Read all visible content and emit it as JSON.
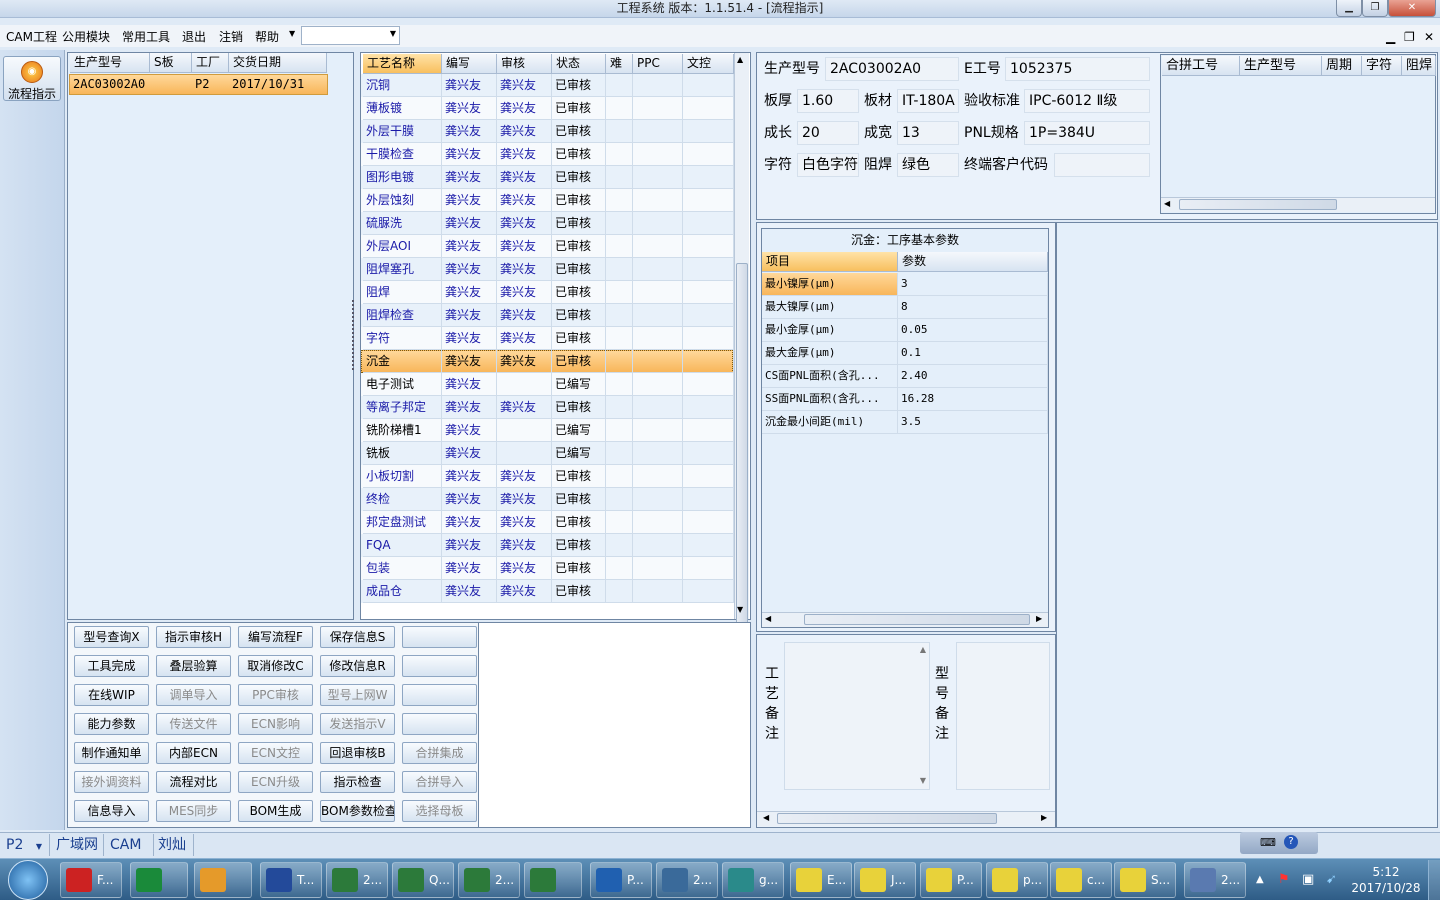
{
  "window": {
    "title": "工程系统    版本：1.1.51.4 - [流程指示]",
    "min_icon": "minimize-icon",
    "max_icon": "maximize-icon",
    "close_icon": "close-icon"
  },
  "menu": {
    "items": [
      "CAM工程",
      "公用模块",
      "常用工具",
      "退出",
      "注销",
      "帮助"
    ],
    "combo_value": ""
  },
  "nav": {
    "flow_button": "流程指示"
  },
  "orders": {
    "columns": [
      "生产型号",
      "S板",
      "工厂",
      "交货日期"
    ],
    "rows": [
      [
        "2AC03002A0",
        "",
        "P2",
        "2017/10/31"
      ]
    ]
  },
  "process": {
    "columns": [
      "工艺名称",
      "编写",
      "审核",
      "状态",
      "难",
      "PPC",
      "文控"
    ],
    "selected_index": 12,
    "rows": [
      [
        "沉铜",
        "龚兴友",
        "龚兴友",
        "已审核"
      ],
      [
        "薄板镀",
        "龚兴友",
        "龚兴友",
        "已审核"
      ],
      [
        "外层干膜",
        "龚兴友",
        "龚兴友",
        "已审核"
      ],
      [
        "干膜检查",
        "龚兴友",
        "龚兴友",
        "已审核"
      ],
      [
        "图形电镀",
        "龚兴友",
        "龚兴友",
        "已审核"
      ],
      [
        "外层蚀刻",
        "龚兴友",
        "龚兴友",
        "已审核"
      ],
      [
        "硫脲洗",
        "龚兴友",
        "龚兴友",
        "已审核"
      ],
      [
        "外层AOI",
        "龚兴友",
        "龚兴友",
        "已审核"
      ],
      [
        "阻焊塞孔",
        "龚兴友",
        "龚兴友",
        "已审核"
      ],
      [
        "阻焊",
        "龚兴友",
        "龚兴友",
        "已审核"
      ],
      [
        "阻焊检查",
        "龚兴友",
        "龚兴友",
        "已审核"
      ],
      [
        "字符",
        "龚兴友",
        "龚兴友",
        "已审核"
      ],
      [
        "沉金",
        "龚兴友",
        "龚兴友",
        "已审核"
      ],
      [
        "电子测试",
        "龚兴友",
        "",
        "已编写"
      ],
      [
        "等离子邦定",
        "龚兴友",
        "龚兴友",
        "已审核"
      ],
      [
        "铣阶梯槽1",
        "龚兴友",
        "",
        "已编写"
      ],
      [
        "铣板",
        "龚兴友",
        "",
        "已编写"
      ],
      [
        "小板切割",
        "龚兴友",
        "龚兴友",
        "已审核"
      ],
      [
        "终检",
        "龚兴友",
        "龚兴友",
        "已审核"
      ],
      [
        "邦定盘测试",
        "龚兴友",
        "龚兴友",
        "已审核"
      ],
      [
        "FQA",
        "龚兴友",
        "龚兴友",
        "已审核"
      ],
      [
        "包装",
        "龚兴友",
        "龚兴友",
        "已审核"
      ],
      [
        "成品仓",
        "龚兴友",
        "龚兴友",
        "已审核"
      ]
    ]
  },
  "buttons": [
    [
      "型号查询X",
      "指示审核H",
      "编写流程F",
      "保存信息S",
      ""
    ],
    [
      "工具完成",
      "叠层验算",
      "取消修改C",
      "修改信息R",
      ""
    ],
    [
      "在线WIP",
      "调单导入",
      "PPC审核",
      "型号上网W",
      ""
    ],
    [
      "能力参数",
      "传送文件",
      "ECN影响",
      "发送指示V",
      ""
    ],
    [
      "制作通知单",
      "内部ECN",
      "ECN文控",
      "回退审核B",
      "合拼集成"
    ],
    [
      "接外调资料",
      "流程对比",
      "ECN升级",
      "指示检查",
      "合拼导入"
    ],
    [
      "信息导入",
      "MES同步",
      "BOM生成",
      "BOM参数检查",
      "选择母板"
    ]
  ],
  "disabled_buttons": [
    "调单导入",
    "PPC审核",
    "型号上网W",
    "传送文件",
    "ECN影响",
    "发送指示V",
    "ECN文控",
    "合拼集成",
    "接外调资料",
    "ECN升级",
    "合拼导入",
    "MES同步",
    "选择母板"
  ],
  "info": {
    "model_label": "生产型号",
    "model_value": "2AC03002A0",
    "e_label": "E工号",
    "e_value": "1052375",
    "thick_label": "板厚",
    "thick_value": "1.60",
    "material_label": "板材",
    "material_value": "IT-180A",
    "std_label": "验收标准",
    "std_value": "IPC-6012 Ⅱ级",
    "len_label": "成长",
    "len_value": "20",
    "wid_label": "成宽",
    "wid_value": "13",
    "pnl_label": "PNL规格",
    "pnl_value": "1P=384U",
    "char_label": "字符",
    "char_value": "白色字符",
    "mask_label": "阻焊",
    "mask_value": "绿色",
    "cust_label": "终端客户代码",
    "cust_value": ""
  },
  "merge": {
    "columns": [
      "合拼工号",
      "生产型号",
      "周期",
      "字符",
      "阻焊"
    ]
  },
  "params": {
    "title": "沉金：工序基本参数",
    "columns": [
      "项目",
      "参数"
    ],
    "rows": [
      [
        "最小镍厚(μm)",
        "3"
      ],
      [
        "最大镍厚(μm)",
        "8"
      ],
      [
        "最小金厚(μm)",
        "0.05"
      ],
      [
        "最大金厚(μm)",
        "0.1"
      ],
      [
        "CS面PNL面积(含孔...",
        "2.40"
      ],
      [
        "SS面PNL面积(含孔...",
        "16.28"
      ],
      [
        "沉金最小间距(mil)",
        "3.5"
      ]
    ]
  },
  "notes": {
    "process_label": "工艺备注",
    "model_label": "型号备注"
  },
  "status": {
    "factory": "P2",
    "tabs": [
      "广域网",
      "CAM",
      "刘灿"
    ]
  },
  "taskbar": {
    "items": [
      "F...",
      "",
      "",
      "T...",
      "2...",
      "Q...",
      "2...",
      "",
      "P...",
      "2...",
      "g...",
      "E...",
      "J...",
      "P...",
      "p...",
      "c...",
      "S...",
      "2..."
    ],
    "time": "5:12",
    "date": "2017/10/28"
  }
}
